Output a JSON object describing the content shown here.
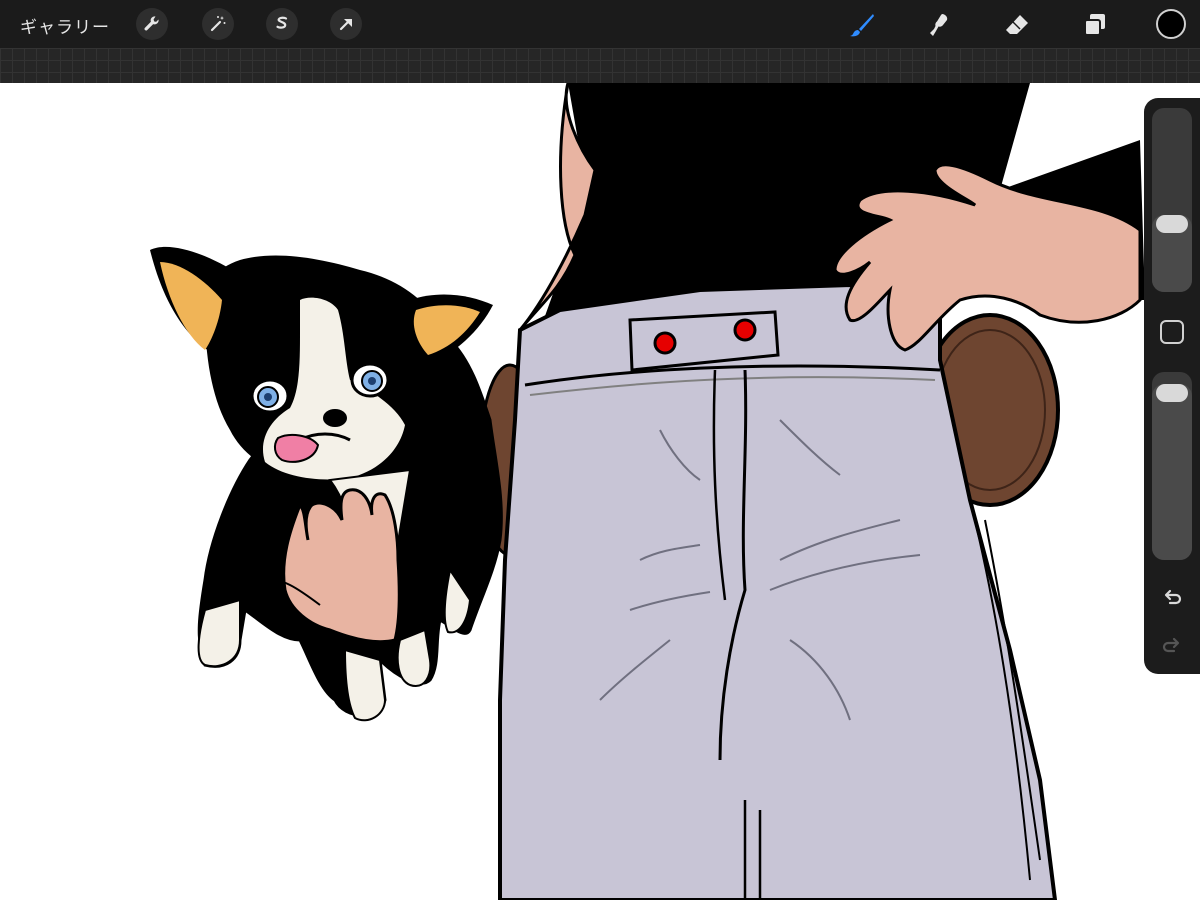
{
  "toolbar": {
    "gallery_label": "ギャラリー",
    "left_buttons": [
      "wrench-icon",
      "magic-wand-icon",
      "selection-s-icon",
      "transform-arrow-icon"
    ],
    "tools": [
      "brush-icon",
      "smudge-icon",
      "eraser-icon",
      "layers-icon"
    ],
    "active_tool": "brush-icon",
    "accent_color": "#2f8cff",
    "current_color": "#000000"
  },
  "sidebar": {
    "brush_size_level": 0.35,
    "opacity_level": 0.95,
    "buttons": [
      "modify-square",
      "undo-icon",
      "redo-icon"
    ]
  },
  "canvas": {
    "background": "#ffffff",
    "palette": {
      "ink": "#000000",
      "shirt": "#000000",
      "pants": "#c8c5d6",
      "skin": "#e8b4a2",
      "pouch": "#6e4530",
      "dog_ears": "#f0b457",
      "dog_eyes": "#7fb0e6",
      "tongue": "#f07fa5",
      "buttons": "#e60000"
    }
  }
}
